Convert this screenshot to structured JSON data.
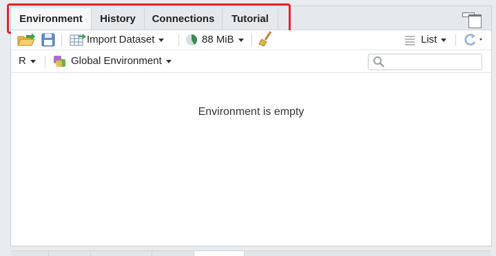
{
  "tabs": [
    {
      "label": "Environment",
      "active": true
    },
    {
      "label": "History",
      "active": false
    },
    {
      "label": "Connections",
      "active": false
    },
    {
      "label": "Tutorial",
      "active": false
    }
  ],
  "toolbar": {
    "import_label": "Import Dataset",
    "memory_label": "88 MiB",
    "view_label": "List"
  },
  "scope": {
    "language": "R",
    "environment_label": "Global Environment"
  },
  "search": {
    "placeholder": ""
  },
  "main": {
    "empty_message": "Environment is empty"
  },
  "colors": {
    "highlight": "#e0242b",
    "tab_active_bg": "#f6f7f8"
  }
}
